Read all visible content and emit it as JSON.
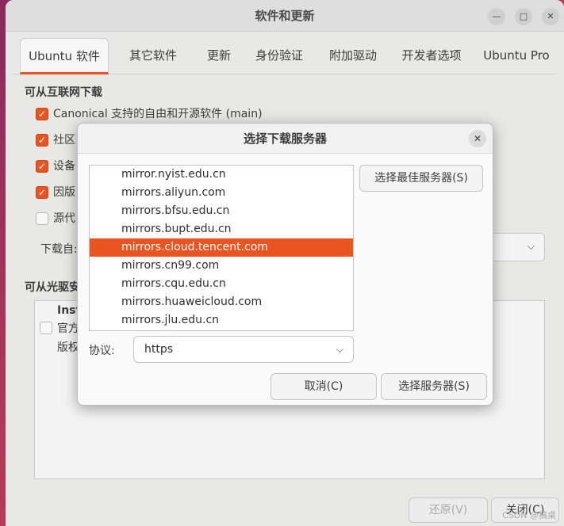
{
  "window": {
    "title": "软件和更新"
  },
  "tabs": [
    "Ubuntu 软件",
    "其它软件",
    "更新",
    "身份验证",
    "附加驱动",
    "开发者选项",
    "Ubuntu Pro"
  ],
  "internet_section": {
    "title": "可从互联网下载",
    "options": [
      {
        "label": "Canonical 支持的自由和开源软件 (main)",
        "checked": true
      },
      {
        "label": "社区",
        "checked": true
      },
      {
        "label": "设备",
        "checked": true
      },
      {
        "label": "因版",
        "checked": true
      },
      {
        "label": "源代",
        "checked": false
      }
    ],
    "download_from_label": "下载自:"
  },
  "cdrom_section": {
    "title": "可从光驱安",
    "item_title": "Inst",
    "item_line1": "官方",
    "item_line2": "版权"
  },
  "bottom_buttons": {
    "revert": "还原(V)",
    "close": "关闭(C)"
  },
  "dialog": {
    "title": "选择下载服务器",
    "servers": [
      "mirror.nyist.edu.cn",
      "mirrors.aliyun.com",
      "mirrors.bfsu.edu.cn",
      "mirrors.bupt.edu.cn",
      "mirrors.cloud.tencent.com",
      "mirrors.cn99.com",
      "mirrors.cqu.edu.cn",
      "mirrors.huaweicloud.com",
      "mirrors.jlu.edu.cn"
    ],
    "selected_server": "mirrors.cloud.tencent.com",
    "best_server_button": "选择最佳服务器(S)",
    "protocol_label": "协议:",
    "protocol_value": "https",
    "cancel_button": "取消(C)",
    "choose_button": "选择服务器(S)"
  },
  "watermark": "CSDN @搞桌",
  "colors": {
    "accent": "#e95420",
    "window_bg": "#e8e8e7",
    "dialog_bg": "#fafafa"
  }
}
